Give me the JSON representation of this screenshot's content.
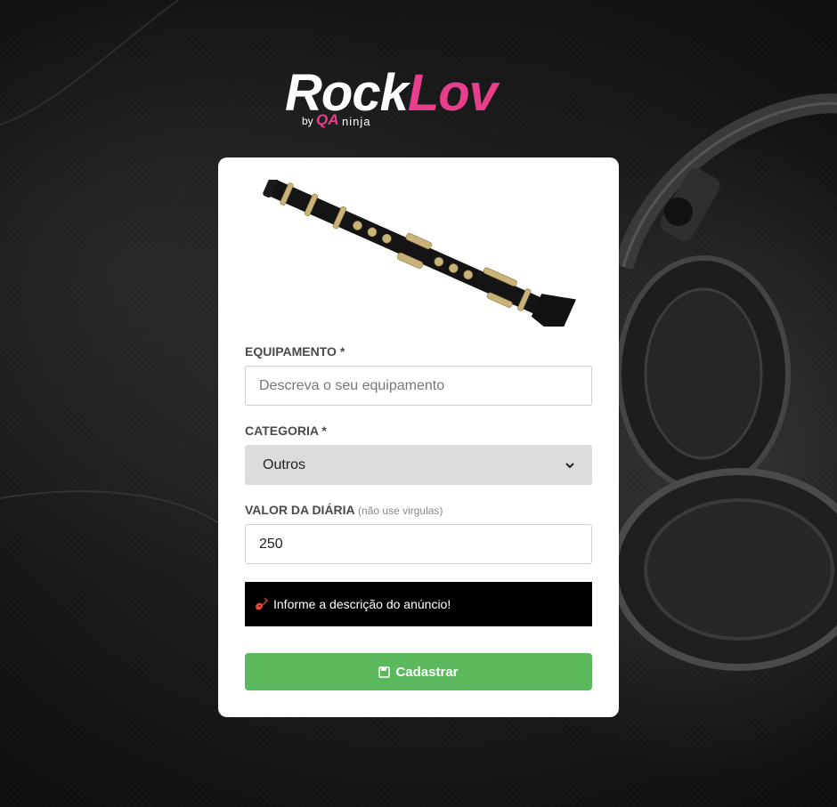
{
  "logo": {
    "rock": "Rock",
    "lov": "Lov",
    "by": "by",
    "qa": "QA",
    "ninja": "ninja"
  },
  "form": {
    "equipment": {
      "label": "EQUIPAMENTO *",
      "placeholder": "Descreva o seu equipamento",
      "value": ""
    },
    "category": {
      "label": "CATEGORIA *",
      "selected": "Outros"
    },
    "price": {
      "label": "VALOR DA DIÁRIA",
      "hint": "(não use virgulas)",
      "value": "250"
    },
    "alert": {
      "icon": "guitar-icon",
      "message": "Informe a descrição do anúncio!"
    },
    "submit": {
      "icon": "floppy-disk-icon",
      "label": "Cadastrar"
    }
  },
  "colors": {
    "brand_pink": "#e83e8c",
    "button_green": "#5cb85c",
    "alert_bg": "#000000"
  }
}
